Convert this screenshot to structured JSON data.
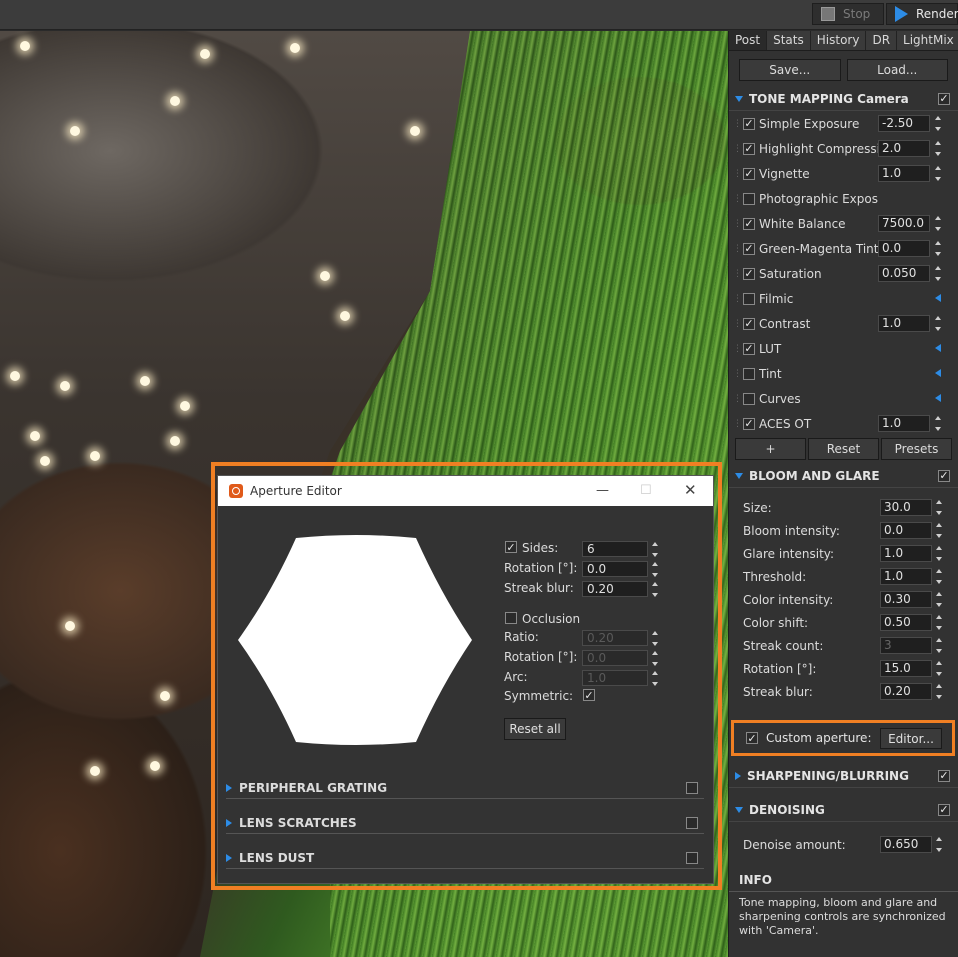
{
  "toolbar": {
    "stop_label": "Stop",
    "render_label": "Render"
  },
  "panel": {
    "tabs": [
      {
        "label": "Post"
      },
      {
        "label": "Stats"
      },
      {
        "label": "History"
      },
      {
        "label": "DR"
      },
      {
        "label": "LightMix"
      }
    ],
    "save_label": "Save...",
    "load_label": "Load...",
    "tone_mapping": {
      "title": "TONE MAPPING",
      "subtitle": "Camera",
      "rows": [
        {
          "label": "Simple Exposure",
          "checked": true,
          "value": "-2.50"
        },
        {
          "label": "Highlight Compression",
          "checked": true,
          "value": "2.0"
        },
        {
          "label": "Vignette",
          "checked": true,
          "value": "1.0"
        },
        {
          "label": "Photographic Exposure",
          "checked": false,
          "value": null
        },
        {
          "label": "White Balance",
          "checked": true,
          "value": "7500.0"
        },
        {
          "label": "Green-Magenta Tint",
          "checked": true,
          "value": "0.0"
        },
        {
          "label": "Saturation",
          "checked": true,
          "value": "0.050"
        },
        {
          "label": "Filmic",
          "checked": false,
          "value": null,
          "expand": true
        },
        {
          "label": "Contrast",
          "checked": true,
          "value": "1.0"
        },
        {
          "label": "LUT",
          "checked": true,
          "value": null,
          "expand": true
        },
        {
          "label": "Tint",
          "checked": false,
          "value": null,
          "expand": true
        },
        {
          "label": "Curves",
          "checked": false,
          "value": null,
          "expand": true
        },
        {
          "label": "ACES OT",
          "checked": true,
          "value": "1.0"
        }
      ],
      "add_label": "+",
      "reset_label": "Reset",
      "presets_label": "Presets"
    },
    "bloom": {
      "title": "BLOOM AND GLARE",
      "rows": [
        {
          "label": "Size:",
          "value": "30.0"
        },
        {
          "label": "Bloom intensity:",
          "value": "0.0"
        },
        {
          "label": "Glare intensity:",
          "value": "1.0"
        },
        {
          "label": "Threshold:",
          "value": "1.0"
        },
        {
          "label": "Color intensity:",
          "value": "0.30"
        },
        {
          "label": "Color shift:",
          "value": "0.50"
        },
        {
          "label": "Streak count:",
          "value": "3",
          "disabled": true
        },
        {
          "label": "Rotation [°]:",
          "value": "15.0"
        },
        {
          "label": "Streak blur:",
          "value": "0.20"
        }
      ],
      "custom_aperture_label": "Custom aperture:",
      "editor_label": "Editor..."
    },
    "sharpening_title": "SHARPENING/BLURRING",
    "denoising": {
      "title": "DENOISING",
      "amount_label": "Denoise amount:",
      "amount_value": "0.650"
    },
    "info": {
      "title": "INFO",
      "text": "Tone mapping, bloom and glare and sharpening controls are synchronized with 'Camera'."
    }
  },
  "dialog": {
    "title": "Aperture Editor",
    "sides_label": "Sides:",
    "sides_value": "6",
    "rotation_label": "Rotation [°]:",
    "rotation_value": "0.0",
    "streak_blur_label": "Streak blur:",
    "streak_blur_value": "0.20",
    "occlusion_label": "Occlusion",
    "ratio_label": "Ratio:",
    "ratio_value": "0.20",
    "occ_rotation_label": "Rotation [°]:",
    "occ_rotation_value": "0.0",
    "arc_label": "Arc:",
    "arc_value": "1.0",
    "symmetric_label": "Symmetric:",
    "reset_all_label": "Reset all",
    "sections": [
      {
        "label": "PERIPHERAL GRATING"
      },
      {
        "label": "LENS SCRATCHES"
      },
      {
        "label": "LENS DUST"
      }
    ]
  },
  "colors": {
    "accent": "#2d8ce6",
    "highlight": "#f07f23",
    "panel_bg": "#323232"
  }
}
